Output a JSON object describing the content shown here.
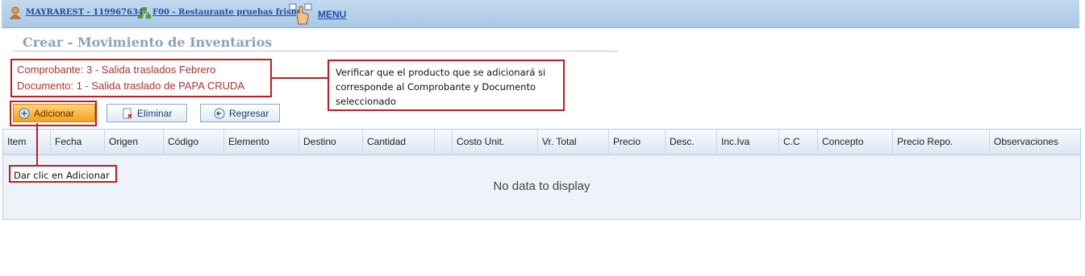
{
  "topbar": {
    "user_label": "MAYRAREST - 119967634",
    "store_label": "F00 - Restaurante pruebas frisby",
    "menu_label": "MENU",
    "icons": {
      "user": "user-icon",
      "network": "network-icon",
      "menu": "hand-pointer-icon"
    }
  },
  "page": {
    "title": "Crear - Movimiento de Inventarios"
  },
  "info": {
    "comprobante": "Comprobante: 3 - Salida traslados Febrero",
    "documento": "Documento: 1 - Salida traslado de PAPA CRUDA"
  },
  "annotations": {
    "verify_note": "Verificar que el producto que se adicionará si corresponde al Comprobante y Documento seleccionado",
    "click_note": "Dar clic en Adicionar",
    "highlight_color": "#c8191f"
  },
  "toolbar": {
    "add_label": "Adicionar",
    "delete_label": "Eliminar",
    "back_label": "Regresar"
  },
  "grid": {
    "columns": [
      "Item",
      "Fecha",
      "Origen",
      "Código",
      "Elemento",
      "Destino",
      "Cantidad",
      "",
      "Costo Unit.",
      "Vr. Total",
      "Precio",
      "Desc.",
      "Inc.Iva",
      "C.C",
      "Concepto",
      "Precio Repo.",
      "Observaciones"
    ],
    "empty_text": "No data to display"
  }
}
